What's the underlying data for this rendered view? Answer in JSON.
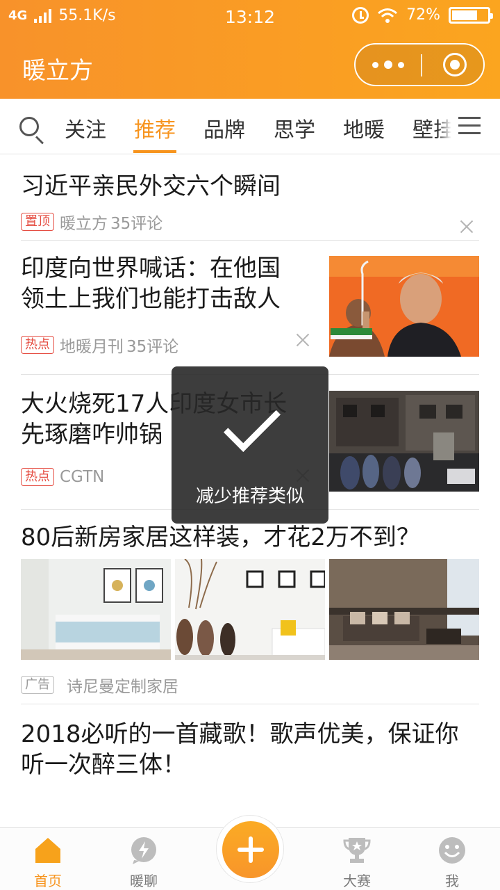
{
  "status_bar": {
    "network": "4G",
    "speed": "55.1K/s",
    "time": "13:12",
    "battery": "72%",
    "battery_level": 0.72
  },
  "header": {
    "title": "暖立方",
    "accent_color": "#f7941e"
  },
  "tabs": {
    "items": [
      "关注",
      "推荐",
      "品牌",
      "思学",
      "地暖",
      "壁挂"
    ],
    "active_index": 1
  },
  "feed": [
    {
      "title": "习近平亲民外交六个瞬间",
      "tag": "置顶",
      "source": "暖立方",
      "comments": "35评论"
    },
    {
      "title_lines": [
        "印度向世界喊话：在他国",
        "领土上我们也能打击敌人"
      ],
      "tag": "热点",
      "source": "地暖月刊",
      "comments": "35评论"
    },
    {
      "title_lines": [
        "大火烧死17人印度女市长",
        "先琢磨咋帅锅"
      ],
      "tag": "热点",
      "source": "CGTN"
    },
    {
      "title": "80后新房家居这样装，才花2万不到？",
      "tag": "广告",
      "source": "诗尼曼定制家居"
    },
    {
      "title_lines": [
        "2018必听的一首藏歌！歌声优美，保证你",
        "听一次醉三体！"
      ]
    }
  ],
  "toast": {
    "text": "减少推荐类似",
    "icon": "check-icon"
  },
  "bottom_nav": {
    "items": [
      {
        "label": "首页",
        "icon": "home-icon",
        "active": true
      },
      {
        "label": "暖聊",
        "icon": "chat-bolt-icon",
        "active": false
      },
      {
        "label": "大赛",
        "icon": "trophy-icon",
        "active": false
      },
      {
        "label": "我",
        "icon": "smiley-icon",
        "active": false
      }
    ],
    "fab_icon": "plus-icon"
  }
}
